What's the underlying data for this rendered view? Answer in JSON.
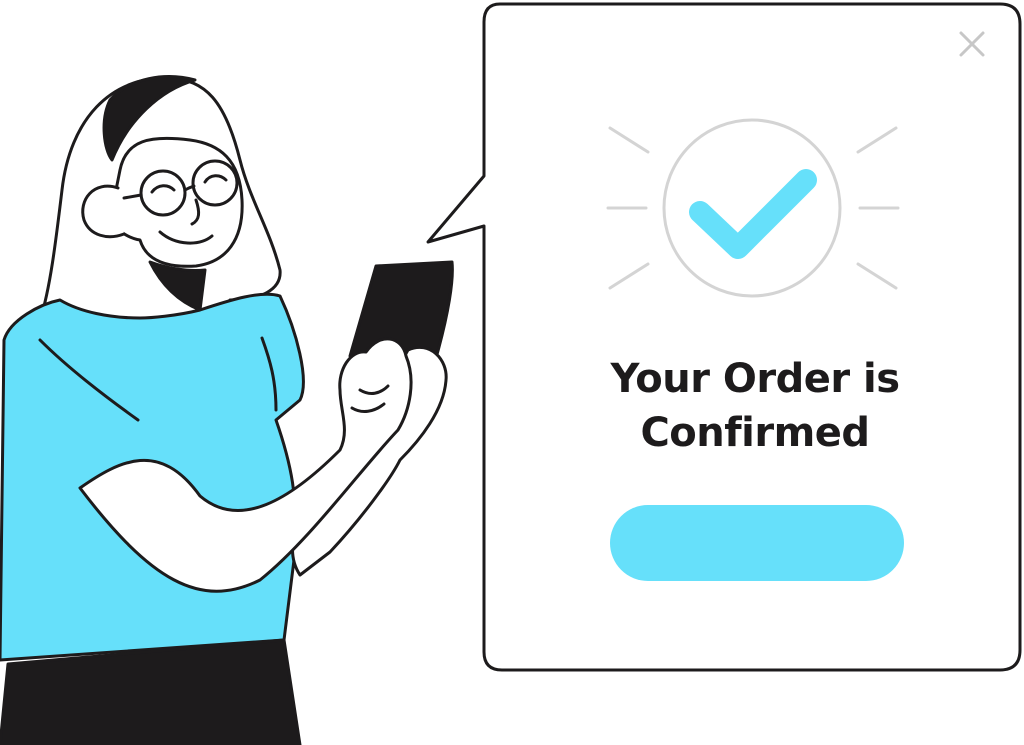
{
  "dialog": {
    "title_line1": "Your Order is",
    "title_line2": "Confirmed",
    "button_label": ""
  },
  "icons": {
    "close": "close-icon",
    "check": "check-icon",
    "phone": "phone-icon"
  },
  "colors": {
    "accent": "#66e0fa",
    "ink": "#1d1b1c",
    "line_gray": "#d4d4d4",
    "white": "#ffffff"
  }
}
